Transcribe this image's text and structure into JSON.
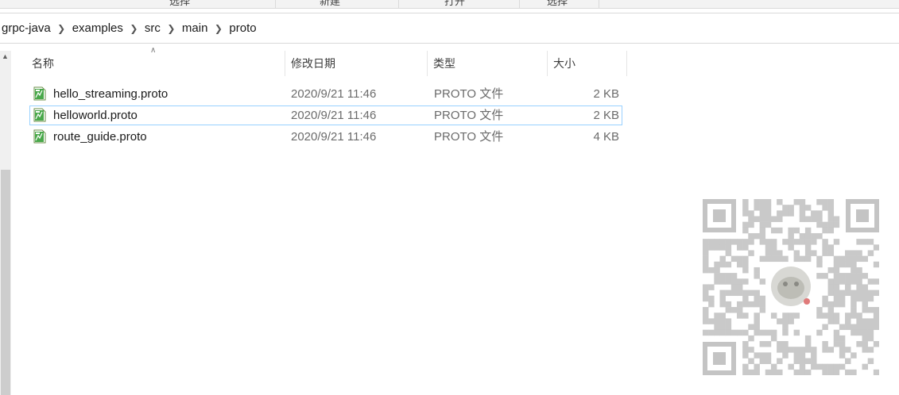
{
  "ribbon": {
    "labels": [
      "选择",
      "新建",
      "打开",
      "选择"
    ]
  },
  "breadcrumb": [
    "grpc-java",
    "examples",
    "src",
    "main",
    "proto"
  ],
  "columns": {
    "name": "名称",
    "date": "修改日期",
    "type": "类型",
    "size": "大小"
  },
  "files": [
    {
      "name": "hello_streaming.proto",
      "date": "2020/9/21 11:46",
      "type": "PROTO 文件",
      "size": "2 KB"
    },
    {
      "name": "helloworld.proto",
      "date": "2020/9/21 11:46",
      "type": "PROTO 文件",
      "size": "2 KB"
    },
    {
      "name": "route_guide.proto",
      "date": "2020/9/21 11:46",
      "type": "PROTO 文件",
      "size": "4 KB"
    }
  ],
  "focused_row": 1,
  "icons": {
    "file": "proto-file-icon",
    "separator": "chevron-right-icon",
    "sort": "sort-up-icon"
  },
  "colors": {
    "focus_border": "#99d1ff",
    "icon_green": "#3aa33a"
  }
}
